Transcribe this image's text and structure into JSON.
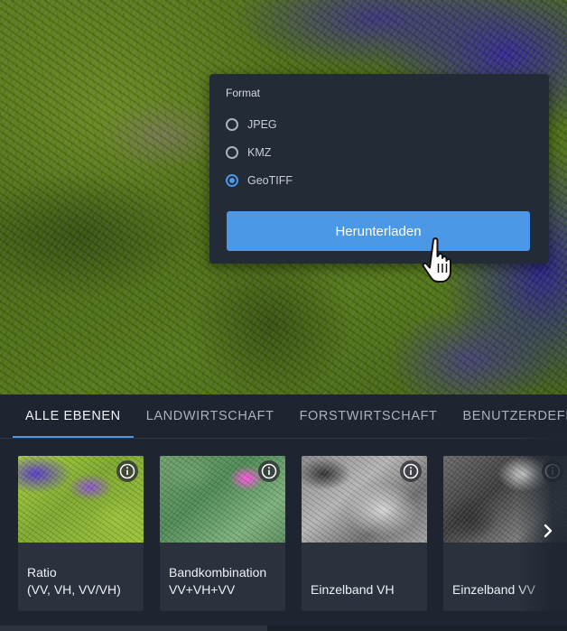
{
  "download_popup": {
    "format_label": "Format",
    "options": [
      {
        "label": "JPEG",
        "selected": false
      },
      {
        "label": "KMZ",
        "selected": false
      },
      {
        "label": "GeoTIFF",
        "selected": true
      }
    ],
    "download_button_label": "Herunterladen"
  },
  "tabs": [
    {
      "label": "ALLE EBENEN",
      "active": true
    },
    {
      "label": "LANDWIRTSCHAFT",
      "active": false
    },
    {
      "label": "FORSTWIRTSCHAFT",
      "active": false
    },
    {
      "label": "BENUTZERDEFINIERT",
      "active": false
    }
  ],
  "layer_cards": [
    {
      "title": "Ratio\n(VV, VH, VV/VH)",
      "icon": "info-icon"
    },
    {
      "title": "Bandkombination\nVV+VH+VV",
      "icon": "info-icon"
    },
    {
      "title": "Einzelband VH",
      "icon": "info-icon"
    },
    {
      "title": "Einzelband VV",
      "icon": "info-icon"
    }
  ],
  "icons": {
    "cursor": "hand-pointer-icon",
    "next": "chevron-right-icon"
  },
  "colors": {
    "accent": "#4a98e6",
    "panel_bg": "#232b36",
    "layers_bg": "#1e2530",
    "card_bg": "#2b323d"
  }
}
